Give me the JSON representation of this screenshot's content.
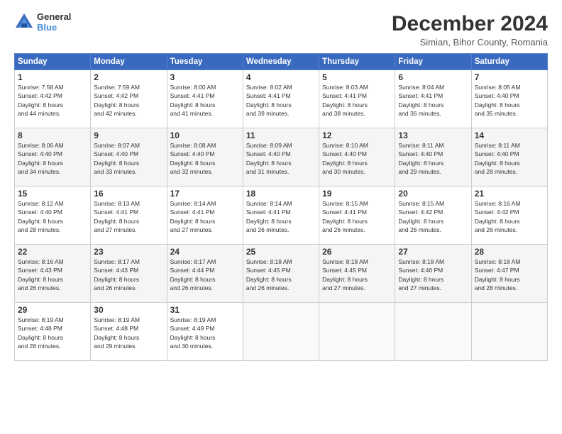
{
  "header": {
    "logo_line1": "General",
    "logo_line2": "Blue",
    "main_title": "December 2024",
    "subtitle": "Simian, Bihor County, Romania"
  },
  "days_of_week": [
    "Sunday",
    "Monday",
    "Tuesday",
    "Wednesday",
    "Thursday",
    "Friday",
    "Saturday"
  ],
  "weeks": [
    [
      {
        "day": "1",
        "info": "Sunrise: 7:58 AM\nSunset: 4:42 PM\nDaylight: 8 hours\nand 44 minutes."
      },
      {
        "day": "2",
        "info": "Sunrise: 7:59 AM\nSunset: 4:42 PM\nDaylight: 8 hours\nand 42 minutes."
      },
      {
        "day": "3",
        "info": "Sunrise: 8:00 AM\nSunset: 4:41 PM\nDaylight: 8 hours\nand 41 minutes."
      },
      {
        "day": "4",
        "info": "Sunrise: 8:02 AM\nSunset: 4:41 PM\nDaylight: 8 hours\nand 39 minutes."
      },
      {
        "day": "5",
        "info": "Sunrise: 8:03 AM\nSunset: 4:41 PM\nDaylight: 8 hours\nand 38 minutes."
      },
      {
        "day": "6",
        "info": "Sunrise: 8:04 AM\nSunset: 4:41 PM\nDaylight: 8 hours\nand 36 minutes."
      },
      {
        "day": "7",
        "info": "Sunrise: 8:05 AM\nSunset: 4:40 PM\nDaylight: 8 hours\nand 35 minutes."
      }
    ],
    [
      {
        "day": "8",
        "info": "Sunrise: 8:06 AM\nSunset: 4:40 PM\nDaylight: 8 hours\nand 34 minutes."
      },
      {
        "day": "9",
        "info": "Sunrise: 8:07 AM\nSunset: 4:40 PM\nDaylight: 8 hours\nand 33 minutes."
      },
      {
        "day": "10",
        "info": "Sunrise: 8:08 AM\nSunset: 4:40 PM\nDaylight: 8 hours\nand 32 minutes."
      },
      {
        "day": "11",
        "info": "Sunrise: 8:09 AM\nSunset: 4:40 PM\nDaylight: 8 hours\nand 31 minutes."
      },
      {
        "day": "12",
        "info": "Sunrise: 8:10 AM\nSunset: 4:40 PM\nDaylight: 8 hours\nand 30 minutes."
      },
      {
        "day": "13",
        "info": "Sunrise: 8:11 AM\nSunset: 4:40 PM\nDaylight: 8 hours\nand 29 minutes."
      },
      {
        "day": "14",
        "info": "Sunrise: 8:11 AM\nSunset: 4:40 PM\nDaylight: 8 hours\nand 28 minutes."
      }
    ],
    [
      {
        "day": "15",
        "info": "Sunrise: 8:12 AM\nSunset: 4:40 PM\nDaylight: 8 hours\nand 28 minutes."
      },
      {
        "day": "16",
        "info": "Sunrise: 8:13 AM\nSunset: 4:41 PM\nDaylight: 8 hours\nand 27 minutes."
      },
      {
        "day": "17",
        "info": "Sunrise: 8:14 AM\nSunset: 4:41 PM\nDaylight: 8 hours\nand 27 minutes."
      },
      {
        "day": "18",
        "info": "Sunrise: 8:14 AM\nSunset: 4:41 PM\nDaylight: 8 hours\nand 26 minutes."
      },
      {
        "day": "19",
        "info": "Sunrise: 8:15 AM\nSunset: 4:41 PM\nDaylight: 8 hours\nand 26 minutes."
      },
      {
        "day": "20",
        "info": "Sunrise: 8:15 AM\nSunset: 4:42 PM\nDaylight: 8 hours\nand 26 minutes."
      },
      {
        "day": "21",
        "info": "Sunrise: 8:16 AM\nSunset: 4:42 PM\nDaylight: 8 hours\nand 26 minutes."
      }
    ],
    [
      {
        "day": "22",
        "info": "Sunrise: 8:16 AM\nSunset: 4:43 PM\nDaylight: 8 hours\nand 26 minutes."
      },
      {
        "day": "23",
        "info": "Sunrise: 8:17 AM\nSunset: 4:43 PM\nDaylight: 8 hours\nand 26 minutes."
      },
      {
        "day": "24",
        "info": "Sunrise: 8:17 AM\nSunset: 4:44 PM\nDaylight: 8 hours\nand 26 minutes."
      },
      {
        "day": "25",
        "info": "Sunrise: 8:18 AM\nSunset: 4:45 PM\nDaylight: 8 hours\nand 26 minutes."
      },
      {
        "day": "26",
        "info": "Sunrise: 8:18 AM\nSunset: 4:45 PM\nDaylight: 8 hours\nand 27 minutes."
      },
      {
        "day": "27",
        "info": "Sunrise: 8:18 AM\nSunset: 4:46 PM\nDaylight: 8 hours\nand 27 minutes."
      },
      {
        "day": "28",
        "info": "Sunrise: 8:18 AM\nSunset: 4:47 PM\nDaylight: 8 hours\nand 28 minutes."
      }
    ],
    [
      {
        "day": "29",
        "info": "Sunrise: 8:19 AM\nSunset: 4:48 PM\nDaylight: 8 hours\nand 28 minutes."
      },
      {
        "day": "30",
        "info": "Sunrise: 8:19 AM\nSunset: 4:48 PM\nDaylight: 8 hours\nand 29 minutes."
      },
      {
        "day": "31",
        "info": "Sunrise: 8:19 AM\nSunset: 4:49 PM\nDaylight: 8 hours\nand 30 minutes."
      },
      null,
      null,
      null,
      null
    ]
  ]
}
